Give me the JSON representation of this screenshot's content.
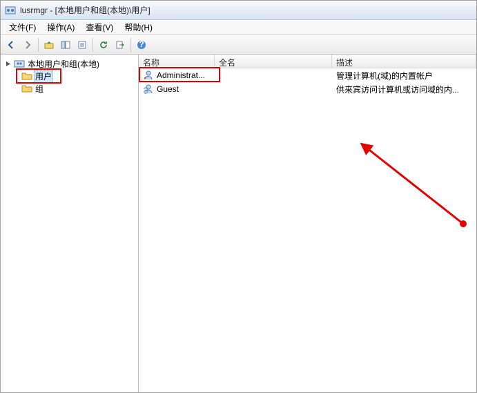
{
  "title": "lusrmgr - [本地用户和组(本地)\\用户]",
  "menu": {
    "file": "文件(F)",
    "action": "操作(A)",
    "view": "查看(V)",
    "help": "帮助(H)"
  },
  "tree": {
    "root": "本地用户和组(本地)",
    "users": "用户",
    "groups": "组"
  },
  "columns": {
    "name": "名称",
    "fullname": "全名",
    "desc": "描述"
  },
  "rows": [
    {
      "name": "Administrat...",
      "fullname": "",
      "desc": "管理计算机(域)的内置帐户"
    },
    {
      "name": "Guest",
      "fullname": "",
      "desc": "供来宾访问计算机或访问域的内..."
    }
  ],
  "colwidths": {
    "name": 110,
    "fullname": 170,
    "desc": 200
  }
}
